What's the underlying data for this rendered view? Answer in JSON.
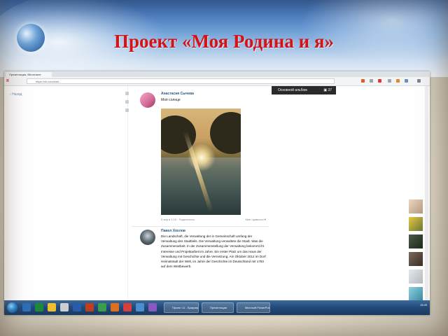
{
  "slide": {
    "title": "Проект «Моя Родина и я»"
  },
  "browser": {
    "tab_title": "Презентация, ВКонтакте",
    "url": "https://vk.com/wall...",
    "logo": "Я"
  },
  "album_label": {
    "text": "Основной альбом",
    "count": "37"
  },
  "left_panel": {
    "back_link": "Назад"
  },
  "post1": {
    "author": "Анастасия Сычева",
    "status": "Моё солнце",
    "footer_left": "5 апр в 1:10 · Поделиться",
    "footer_right": "Мне нравится"
  },
  "post2": {
    "author": "Павел Хохлов",
    "text": "Die Landschaft, die Verwaltung der in Gemeinschaft umfang der Verwaltung des Stadtteils. Die Verwaltung verwaltete die Stadt. Was die Zusammenarbeit. In der Zusammenstellung der Verwaltung bekommt ihr Interesse und Projektarbeit im Jahre. Ein erster Platz um das Haus der Verwaltung mit Geschichte und die Vernetzung. Am Oktober 2012 im Dorf Heimatstadt der Welt, im Jahre der Geschichte im Deutschland mit 1783 auf dem Wettbewerb."
  },
  "taskbar": {
    "window1": "Проект 11 - Браузер",
    "window2": "Презентация",
    "window3": "Microsoft PowerPoint",
    "clock": "15:45"
  },
  "colors": {
    "title_red": "#d01418",
    "vk_blue": "#2a5885",
    "taskbar": "#214a7a"
  },
  "icons": [
    "globe-ornament-icon",
    "back-arrow-icon",
    "camera-icon",
    "like-heart-icon",
    "start-orb-icon"
  ]
}
